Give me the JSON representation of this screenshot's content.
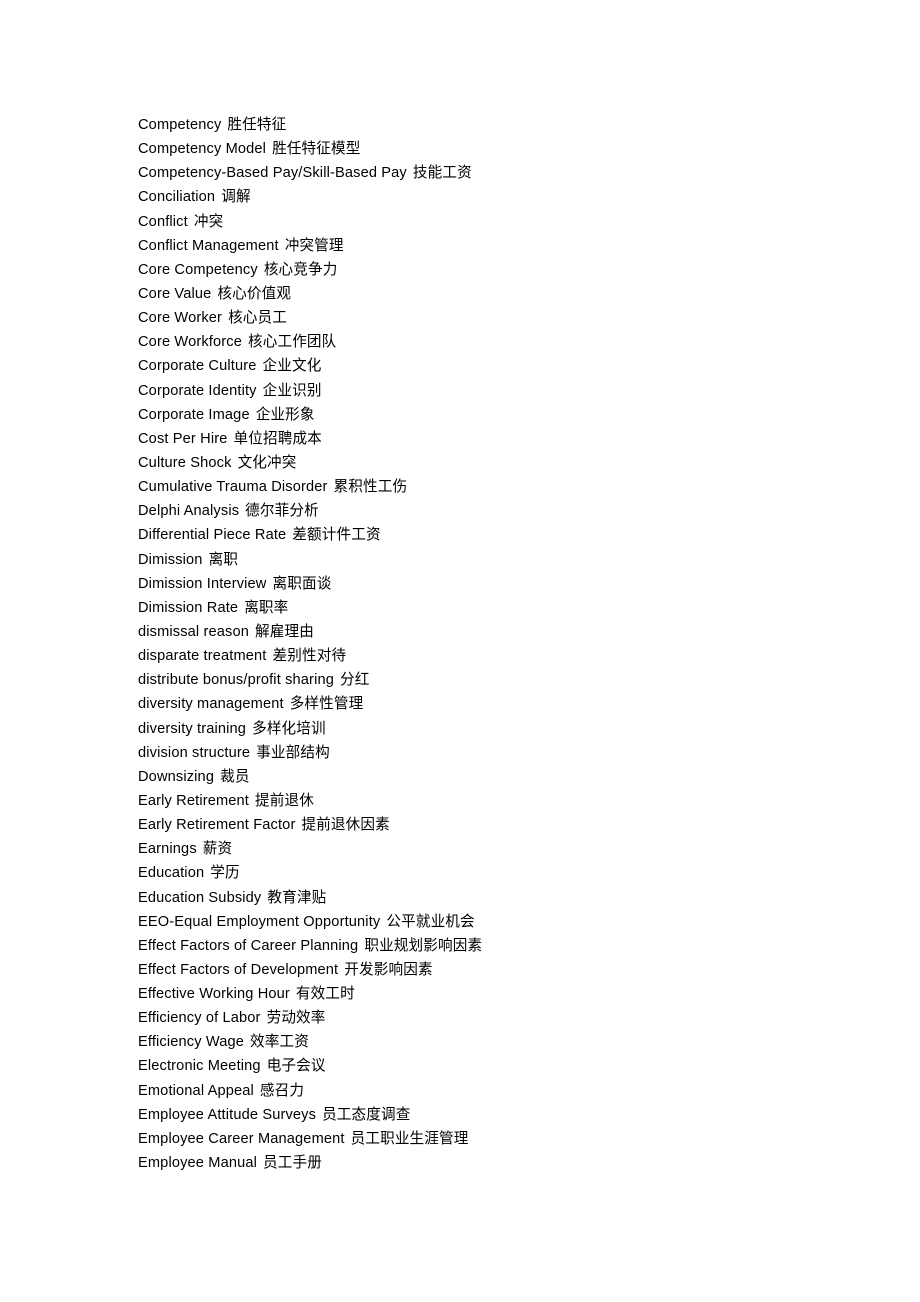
{
  "document": {
    "type": "bilingual-glossary",
    "page_background": "#ffffff",
    "text_color": "#000000",
    "entries": [
      {
        "en": "Competency",
        "zh": "胜任特征"
      },
      {
        "en": "Competency Model",
        "zh": "胜任特征模型"
      },
      {
        "en": "Competency-Based Pay/Skill-Based Pay",
        "zh": "技能工资"
      },
      {
        "en": "Conciliation",
        "zh": "调解"
      },
      {
        "en": "Conflict",
        "zh": "冲突"
      },
      {
        "en": "Conflict Management",
        "zh": "冲突管理"
      },
      {
        "en": "Core Competency",
        "zh": "核心竞争力"
      },
      {
        "en": "Core Value",
        "zh": "核心价值观"
      },
      {
        "en": "Core Worker",
        "zh": "核心员工"
      },
      {
        "en": "Core Workforce",
        "zh": "核心工作团队"
      },
      {
        "en": "Corporate Culture",
        "zh": "企业文化"
      },
      {
        "en": "Corporate Identity",
        "zh": "企业识别"
      },
      {
        "en": "Corporate Image",
        "zh": "企业形象"
      },
      {
        "en": "Cost Per Hire",
        "zh": "单位招聘成本"
      },
      {
        "en": "Culture Shock",
        "zh": "文化冲突"
      },
      {
        "en": "Cumulative Trauma Disorder",
        "zh": "累积性工伤"
      },
      {
        "en": "Delphi Analysis",
        "zh": "德尔菲分析"
      },
      {
        "en": "Differential Piece Rate",
        "zh": "差额计件工资"
      },
      {
        "en": "Dimission",
        "zh": "离职"
      },
      {
        "en": "Dimission Interview",
        "zh": "离职面谈"
      },
      {
        "en": "Dimission Rate",
        "zh": "离职率"
      },
      {
        "en": "dismissal reason",
        "zh": "解雇理由"
      },
      {
        "en": "disparate treatment",
        "zh": "差别性对待"
      },
      {
        "en": "distribute bonus/profit sharing",
        "zh": "分红"
      },
      {
        "en": "diversity management",
        "zh": "多样性管理"
      },
      {
        "en": "diversity training",
        "zh": "多样化培训"
      },
      {
        "en": "division structure",
        "zh": "事业部结构"
      },
      {
        "en": "Downsizing",
        "zh": "裁员"
      },
      {
        "en": "Early Retirement",
        "zh": "提前退休"
      },
      {
        "en": "Early Retirement Factor",
        "zh": "提前退休因素"
      },
      {
        "en": "Earnings",
        "zh": "薪资"
      },
      {
        "en": "Education",
        "zh": "学历"
      },
      {
        "en": "Education Subsidy",
        "zh": "教育津贴"
      },
      {
        "en": "EEO-Equal Employment Opportunity",
        "zh": "公平就业机会"
      },
      {
        "en": "Effect Factors of Career Planning",
        "zh": "职业规划影响因素"
      },
      {
        "en": "Effect Factors of Development",
        "zh": "开发影响因素"
      },
      {
        "en": "Effective Working Hour",
        "zh": "有效工时"
      },
      {
        "en": "Efficiency of Labor",
        "zh": "劳动效率"
      },
      {
        "en": "Efficiency Wage",
        "zh": "效率工资"
      },
      {
        "en": "Electronic Meeting",
        "zh": "电子会议"
      },
      {
        "en": "Emotional Appeal",
        "zh": "感召力"
      },
      {
        "en": "Employee Attitude Surveys",
        "zh": "员工态度调查"
      },
      {
        "en": "Employee Career Management",
        "zh": "员工职业生涯管理"
      },
      {
        "en": "Employee Manual",
        "zh": "员工手册"
      }
    ]
  }
}
